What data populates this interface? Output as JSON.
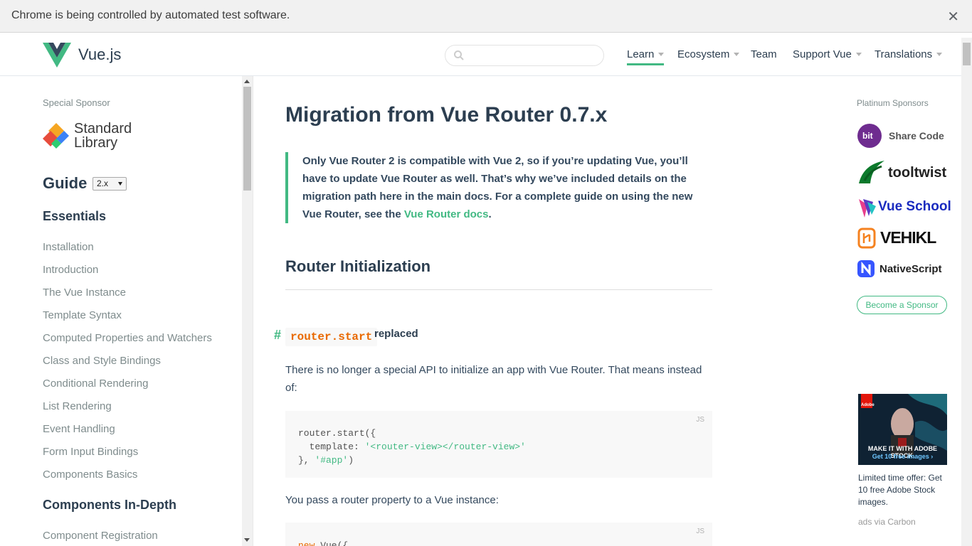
{
  "infobar": {
    "message": "Chrome is being controlled by automated test software.",
    "close_glyph": "✕"
  },
  "header": {
    "brand": "Vue.js",
    "search": {
      "placeholder": "",
      "value": ""
    },
    "nav": [
      {
        "label": "Learn",
        "has_caret": true,
        "active": true
      },
      {
        "label": "Ecosystem",
        "has_caret": true
      },
      {
        "label": "Team",
        "has_caret": false
      },
      {
        "label": "Support Vue",
        "has_caret": true
      },
      {
        "label": "Translations",
        "has_caret": true
      }
    ]
  },
  "sidebar": {
    "special_sponsor_label": "Special Sponsor",
    "sponsor_line1": "Standard",
    "sponsor_line2": "Library",
    "guide_title": "Guide",
    "version": "2.x",
    "sections": [
      {
        "title": "Essentials",
        "items": [
          "Installation",
          "Introduction",
          "The Vue Instance",
          "Template Syntax",
          "Computed Properties and Watchers",
          "Class and Style Bindings",
          "Conditional Rendering",
          "List Rendering",
          "Event Handling",
          "Form Input Bindings",
          "Components Basics"
        ]
      },
      {
        "title": "Components In-Depth",
        "items": [
          "Component Registration"
        ]
      }
    ]
  },
  "content": {
    "title": "Migration from Vue Router 0.7.x",
    "tip_text": "Only Vue Router 2 is compatible with Vue 2, so if you’re updating Vue, you’ll have to update Vue Router as well. That’s why we’ve included details on the migration path here in the main docs. For a complete guide on using the new Vue Router, see the ",
    "tip_link": "Vue Router docs",
    "tip_end": ".",
    "section_title": "Router Initialization",
    "anchor": "#",
    "h3_code": "router.start",
    "h3_rest": "replaced",
    "para1": "There is no longer a special API to initialize an app with Vue Router. That means instead of:",
    "code1": {
      "lang": "JS",
      "line1": "router.start({",
      "line2_prefix": "  template: ",
      "line2_str": "'<router-view></router-view>'",
      "line3_prefix": "}, ",
      "line3_str": "'#app'",
      "line3_suffix": ")"
    },
    "para2": "You pass a router property to a Vue instance:",
    "code2": {
      "lang": "JS",
      "line1_kw": "new",
      "line1_rest": " Vue({"
    }
  },
  "rail": {
    "platinum_label": "Platinum Sponsors",
    "sponsors": [
      {
        "name": "Share Code",
        "badge": "bit",
        "color": "#6e2c8f"
      },
      {
        "name": "tooltwist",
        "color": "#0c7a2c"
      },
      {
        "name": "Vue School",
        "color": "#1a2bbf"
      },
      {
        "name": "VEHIKL",
        "color": "#111111"
      },
      {
        "name": "NativeScript",
        "color": "#3655ff"
      }
    ],
    "become_sponsor": "Become a Sponsor",
    "ad_headline": "MAKE IT WITH ADOBE STOCK.",
    "ad_sub": "Get 10 free images ›",
    "ad_brand": "Adobe",
    "ad_text": "Limited time offer: Get 10 free Adobe Stock images.",
    "ad_via": "ads via Carbon"
  },
  "colors": {
    "accent": "#42b983",
    "heading": "#2c3e50",
    "text": "#34495e",
    "muted": "#7f8c8d",
    "code_orange": "#e96900"
  }
}
